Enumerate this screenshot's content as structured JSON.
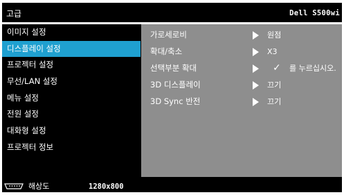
{
  "header": {
    "title": "고급",
    "model": "Dell S500wi"
  },
  "sidebar": {
    "items": [
      {
        "label": "이미지 설정"
      },
      {
        "label": "디스플레이 설정",
        "active": true
      },
      {
        "label": "프로젝터 설정"
      },
      {
        "label": "무선/LAN 설정"
      },
      {
        "label": "메뉴 설정"
      },
      {
        "label": "전원 설정"
      },
      {
        "label": "대화형 설정"
      },
      {
        "label": "프로젝터 정보"
      }
    ]
  },
  "panel": {
    "rows": [
      {
        "label": "가로세로비",
        "value": "원점"
      },
      {
        "label": "확대/축소",
        "value": "X3"
      },
      {
        "label": "선택부분 확대",
        "value": "를 누르십시오.",
        "icon": "check-icon"
      },
      {
        "label": "3D 디스플레이",
        "value": "끄기"
      },
      {
        "label": "3D Sync 반전",
        "value": "끄기"
      }
    ]
  },
  "footer": {
    "icon": "vga-input-icon",
    "resolution_label": "해상도",
    "resolution_value": "1280x800"
  },
  "colors": {
    "background": "#000000",
    "highlight": "#1fa0d0",
    "panel": "#8e8e8e",
    "text": "#ffffff"
  }
}
